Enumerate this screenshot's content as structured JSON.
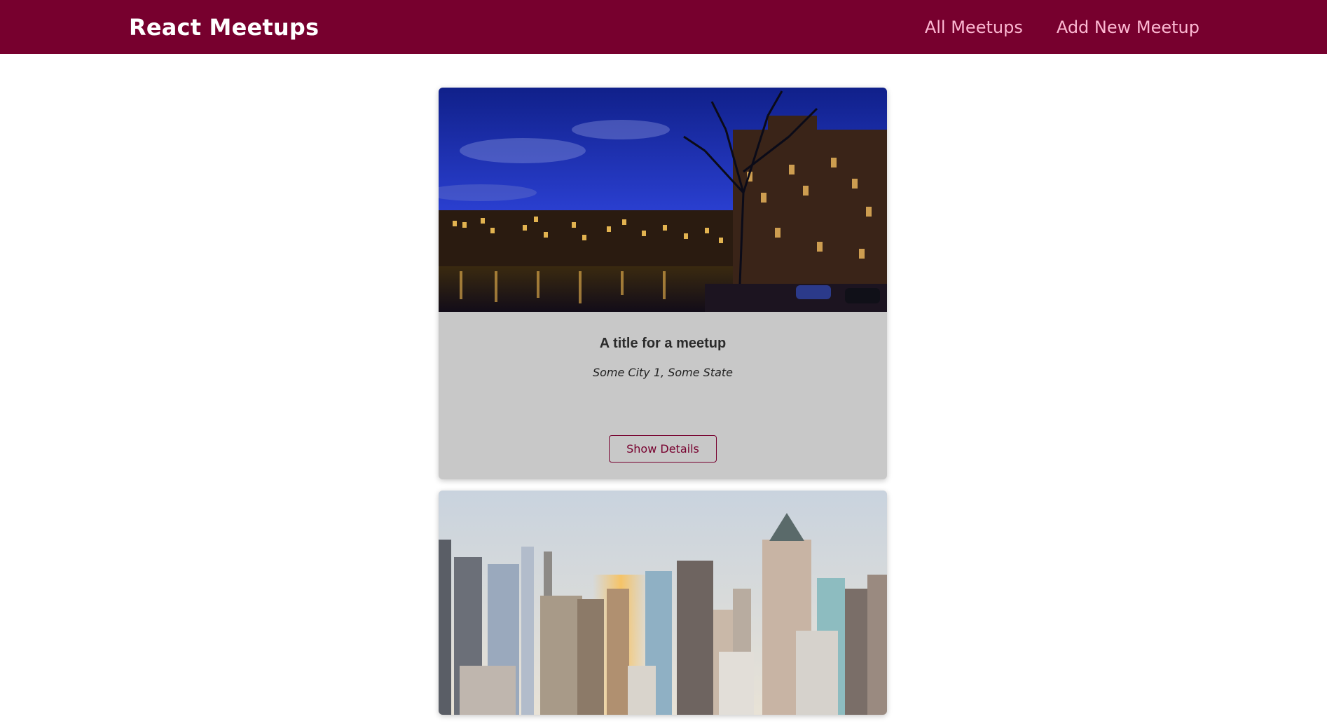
{
  "header": {
    "logo": "React Meetups",
    "nav": {
      "all_meetups": "All Meetups",
      "add_meetup": "Add New Meetup"
    }
  },
  "colors": {
    "brand": "#77002e",
    "nav_link": "#fcb8d2",
    "card_bg": "#c8c8c8"
  },
  "meetups": [
    {
      "title": "A title for a meetup",
      "address": "Some City 1, Some State",
      "button": "Show Details",
      "image": "amsterdam-canal-night-photo"
    },
    {
      "title": "",
      "address": "",
      "button": "",
      "image": "city-skyline-photo"
    }
  ]
}
